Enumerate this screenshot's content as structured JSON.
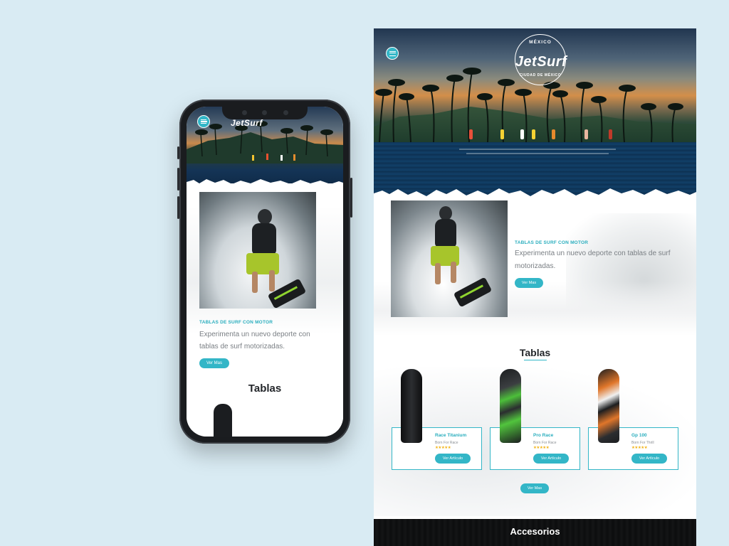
{
  "brand": {
    "logo_text": "JetSurf",
    "logo_top": "MÉXICO",
    "logo_bottom": "CIUDAD DE MÉXICO",
    "accent": "#33b6c7"
  },
  "feature": {
    "tag": "TABLAS DE SURF CON MOTOR",
    "description": "Experimenta un nuevo deporte con tablas de surf motorizadas.",
    "button": "Ver Mas"
  },
  "tablas": {
    "title": "Tablas",
    "more_button": "Ver Mas",
    "products": [
      {
        "name": "Race Titanium",
        "subtitle": "Born For Race",
        "rating": "★★★★★",
        "button": "Ver Artículo"
      },
      {
        "name": "Pro Race",
        "subtitle": "Born For Race",
        "rating": "★★★★★",
        "button": "Ver Artículo"
      },
      {
        "name": "Gp 100",
        "subtitle": "Born For Thrill",
        "rating": "★★★★★",
        "button": "Ver Artículo"
      }
    ]
  },
  "accesorios": {
    "title": "Accesorios"
  },
  "mobile": {
    "logo_text": "JetSurf",
    "tag": "TABLAS DE SURF CON MOTOR",
    "description": "Experimenta un nuevo deporte con tablas de surf motorizadas.",
    "button": "Ver Mas",
    "section_title": "Tablas"
  },
  "icons": [
    "menu-icon",
    "logo-badge-icon",
    "star-rating-icon"
  ]
}
